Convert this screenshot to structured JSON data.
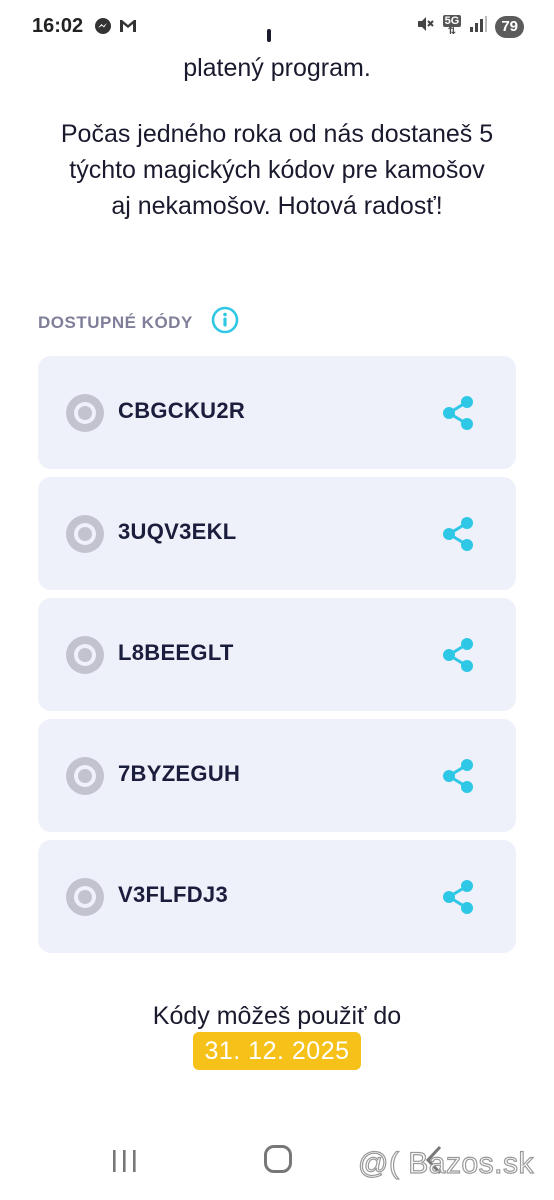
{
  "status_bar": {
    "time": "16:02",
    "battery": "79",
    "network": "5G",
    "icons": [
      "messenger-icon",
      "gmail-icon",
      "mute-icon",
      "signal-icon"
    ]
  },
  "intro": {
    "line1": "platený program.",
    "para2_lines": [
      "Počas jedného roka od nás dostaneš 5",
      "týchto magických kódov pre kamošov",
      "aj nekamošov. Hotová radosť!"
    ]
  },
  "section": {
    "label": "DOSTUPNÉ KÓDY",
    "info_icon": "info-icon"
  },
  "codes": [
    {
      "code": "CBGCKU2R"
    },
    {
      "code": "3UQV3EKL"
    },
    {
      "code": "L8BEEGLT"
    },
    {
      "code": "7BYZEGUH"
    },
    {
      "code": "V3FLFDJ3"
    }
  ],
  "expiry": {
    "text": "Kódy môžeš použiť do",
    "date": "31. 12. 2025"
  },
  "watermark": "@( Bazos.sk",
  "colors": {
    "accent": "#2ec8e6",
    "card_bg": "#eef0fa",
    "badge": "#f6c219",
    "label": "#7f7f9a"
  }
}
